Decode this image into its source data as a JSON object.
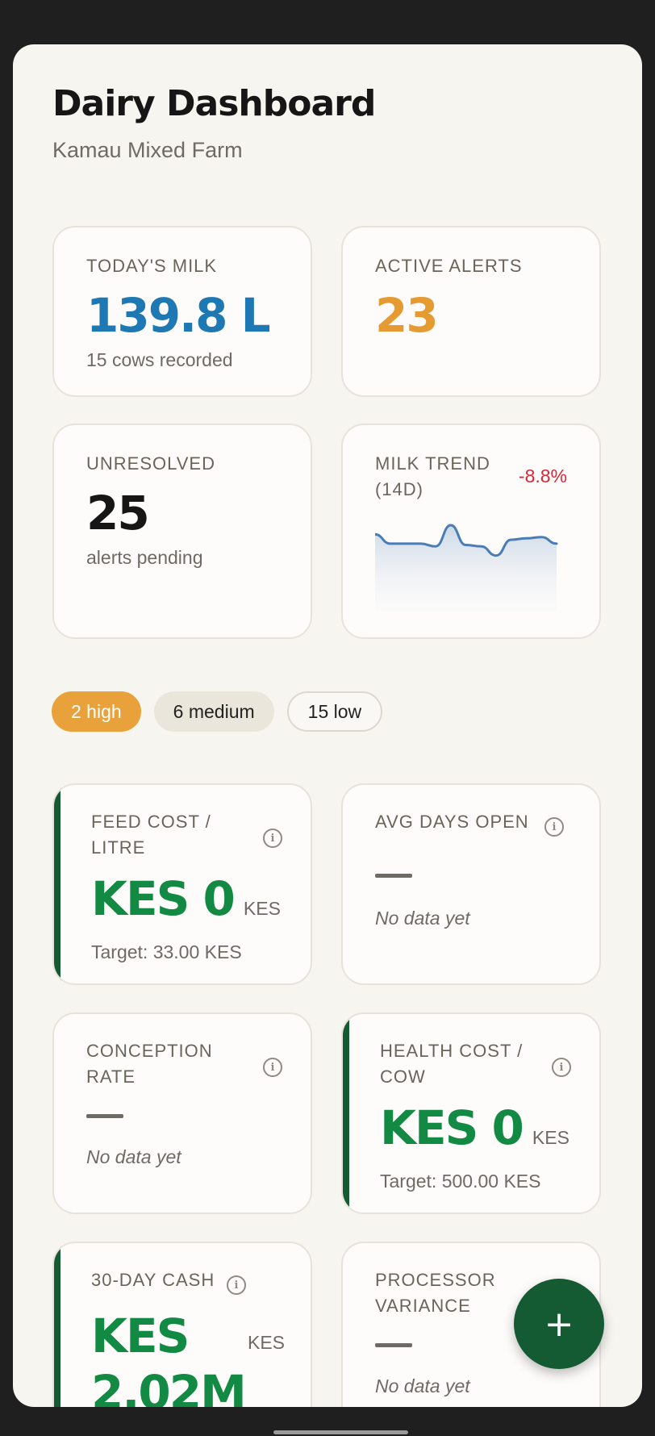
{
  "header": {
    "title": "Dairy Dashboard",
    "farm_name": "Kamau Mixed Farm"
  },
  "stats": {
    "todays_milk": {
      "label": "TODAY'S MILK",
      "value": "139.8 L",
      "sub": "15 cows recorded",
      "color": "#1e78b4"
    },
    "active_alerts": {
      "label": "ACTIVE ALERTS",
      "value": "23",
      "color": "#e69a32"
    },
    "unresolved": {
      "label": "UNRESOLVED",
      "value": "25",
      "sub": "alerts pending",
      "color": "#161616"
    },
    "milk_trend": {
      "label_line1": "MILK TREND",
      "label_line2": "(14D)",
      "change": "-8.8%",
      "change_color": "#d62839",
      "sparkline": [
        91,
        84,
        84,
        84,
        82,
        98,
        83,
        82,
        75,
        87,
        88,
        89,
        84
      ]
    }
  },
  "chips": [
    {
      "label": "2 high",
      "style": "high",
      "bg": "#e9a23b",
      "fg": "#ffffff"
    },
    {
      "label": "6 medium",
      "style": "medium",
      "bg": "#ebe6dc",
      "fg": "#222222"
    },
    {
      "label": "15 low",
      "style": "low",
      "bg": "#faf8f4",
      "fg": "#222222"
    }
  ],
  "kpis": {
    "feed_cost": {
      "label_line1": "FEED COST /",
      "label_line2": "LITRE",
      "value": "KES 0",
      "unit": "KES",
      "target": "Target: 33.00 KES",
      "value_color": "#138a43"
    },
    "avg_days_open": {
      "label": "AVG DAYS OPEN",
      "empty": "No data yet"
    },
    "conception_rate": {
      "label_line1": "CONCEPTION",
      "label_line2": "RATE",
      "empty": "No data yet"
    },
    "health_cost": {
      "label_line1": "HEALTH COST /",
      "label_line2": "COW",
      "value": "KES 0",
      "unit": "KES",
      "target": "Target: 500.00 KES",
      "value_color": "#138a43"
    },
    "cash_30day": {
      "label": "30-DAY CASH",
      "value_line1": "KES",
      "value_line2": "2.02M",
      "unit": "KES",
      "value_color": "#138a43"
    },
    "processor_variance": {
      "label_line1": "PROCESSOR",
      "label_line2": "VARIANCE",
      "empty": "No data yet"
    }
  },
  "fab": {
    "icon": "plus-icon",
    "glyph": "+"
  },
  "colors": {
    "accent_green": "#145a32",
    "background": "#f7f5f0"
  }
}
